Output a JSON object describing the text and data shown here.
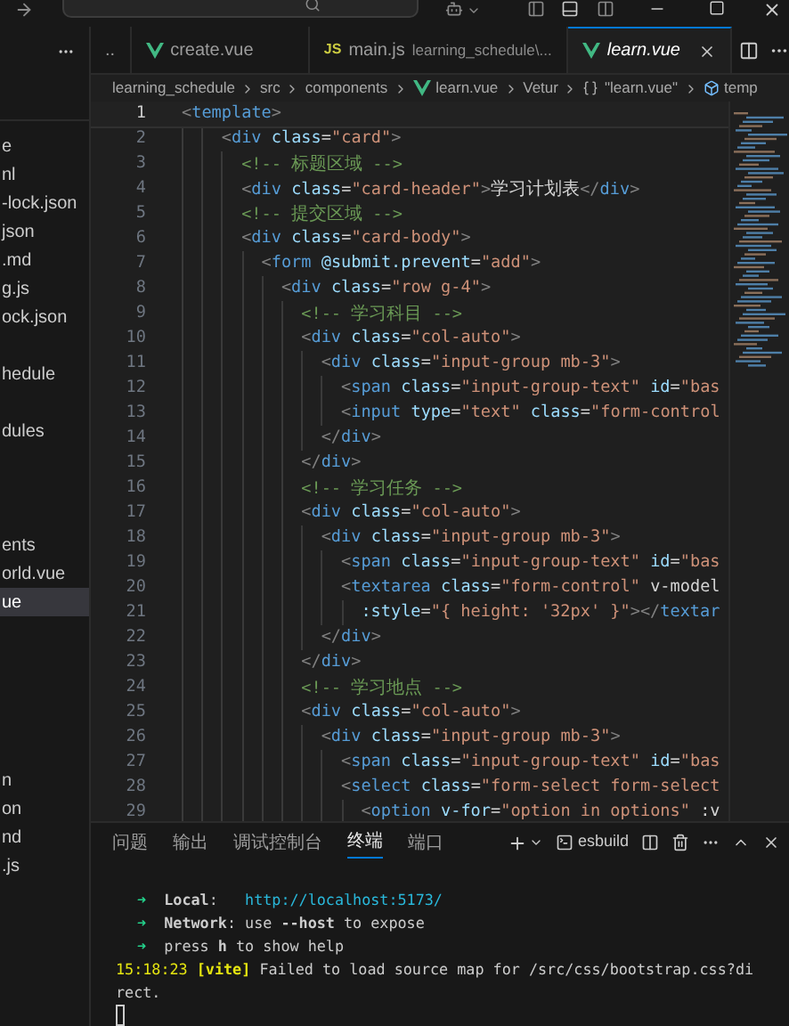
{
  "editor_tabs": [
    {
      "label": "..",
      "kind": "plain",
      "selected": false
    },
    {
      "label": "create.vue",
      "kind": "vue",
      "selected": false
    },
    {
      "label": "main.js",
      "kind": "js",
      "icon_text": "JS",
      "description": "learning_schedule\\...",
      "selected": false
    },
    {
      "label": "learn.vue",
      "kind": "vue",
      "selected": true
    }
  ],
  "breadcrumbs": [
    {
      "label": "learning_schedule",
      "kind": "plain"
    },
    {
      "label": "src",
      "kind": "plain"
    },
    {
      "label": "components",
      "kind": "plain"
    },
    {
      "label": "learn.vue",
      "kind": "vue"
    },
    {
      "label": "Vetur",
      "kind": "plain"
    },
    {
      "label": "\"learn.vue\"",
      "kind": "braces"
    },
    {
      "label": "temp",
      "kind": "cube"
    }
  ],
  "explorer": {
    "groups": [
      [
        {
          "label": "e",
          "selected": false
        },
        {
          "label": "nl",
          "selected": false
        },
        {
          "label": "-lock.json",
          "selected": false
        },
        {
          "label": "json",
          "selected": false
        },
        {
          "label": ".md",
          "selected": false
        },
        {
          "label": "g.js",
          "selected": false
        },
        {
          "label": "ock.json",
          "selected": false
        }
      ],
      [
        {
          "label": "hedule",
          "selected": false
        }
      ],
      [
        {
          "label": "dules",
          "selected": false
        }
      ],
      [
        {
          "label": "ents",
          "selected": false
        },
        {
          "label": "orld.vue",
          "selected": false
        },
        {
          "label": "ue",
          "selected": true
        }
      ],
      [
        {
          "label": "n",
          "selected": false
        },
        {
          "label": "on",
          "selected": false
        },
        {
          "label": "nd",
          "selected": false
        },
        {
          "label": ".js",
          "selected": false
        }
      ]
    ]
  },
  "editor": {
    "lines": [
      {
        "number": "1",
        "code": "<template>",
        "current": true
      },
      {
        "number": "2",
        "code": "    <div class=\"card\">",
        "current": false
      },
      {
        "number": "3",
        "code": "      <!-- 标题区域 -->",
        "current": false
      },
      {
        "number": "4",
        "code": "      <div class=\"card-header\">学习计划表</div>",
        "current": false
      },
      {
        "number": "5",
        "code": "      <!-- 提交区域 -->",
        "current": false
      },
      {
        "number": "6",
        "code": "      <div class=\"card-body\">",
        "current": false
      },
      {
        "number": "7",
        "code": "        <form @submit.prevent=\"add\">",
        "current": false
      },
      {
        "number": "8",
        "code": "          <div class=\"row g-4\">",
        "current": false
      },
      {
        "number": "9",
        "code": "            <!-- 学习科目 -->",
        "current": false
      },
      {
        "number": "10",
        "code": "            <div class=\"col-auto\">",
        "current": false
      },
      {
        "number": "11",
        "code": "              <div class=\"input-group mb-3\">",
        "current": false
      },
      {
        "number": "12",
        "code": "                <span class=\"input-group-text\" id=\"bas",
        "current": false
      },
      {
        "number": "13",
        "code": "                <input type=\"text\" class=\"form-control",
        "current": false
      },
      {
        "number": "14",
        "code": "              </div>",
        "current": false
      },
      {
        "number": "15",
        "code": "            </div>",
        "current": false
      },
      {
        "number": "16",
        "code": "            <!-- 学习任务 -->",
        "current": false
      },
      {
        "number": "17",
        "code": "            <div class=\"col-auto\">",
        "current": false
      },
      {
        "number": "18",
        "code": "              <div class=\"input-group mb-3\">",
        "current": false
      },
      {
        "number": "19",
        "code": "                <span class=\"input-group-text\" id=\"bas",
        "current": false
      },
      {
        "number": "20",
        "code": "                <textarea class=\"form-control\" v-model",
        "current": false
      },
      {
        "number": "21",
        "code": "                  :style=\"{ height: '32px' }\"></textar",
        "current": false
      },
      {
        "number": "22",
        "code": "              </div>",
        "current": false
      },
      {
        "number": "23",
        "code": "            </div>",
        "current": false
      },
      {
        "number": "24",
        "code": "            <!-- 学习地点 -->",
        "current": false
      },
      {
        "number": "25",
        "code": "            <div class=\"col-auto\">",
        "current": false
      },
      {
        "number": "26",
        "code": "              <div class=\"input-group mb-3\">",
        "current": false
      },
      {
        "number": "27",
        "code": "                <span class=\"input-group-text\" id=\"bas",
        "current": false
      },
      {
        "number": "28",
        "code": "                <select class=\"form-select form-select",
        "current": false
      },
      {
        "number": "29",
        "code": "                  <option v-for=\"option in options\" :v",
        "current": false
      }
    ]
  },
  "panel": {
    "tabs": [
      {
        "label": "问题",
        "selected": false
      },
      {
        "label": "输出",
        "selected": false
      },
      {
        "label": "调试控制台",
        "selected": false
      },
      {
        "label": "终端",
        "selected": true
      },
      {
        "label": "端口",
        "selected": false
      }
    ],
    "terminal_name": "esbuild",
    "terminal": [
      {
        "kind": "arrow",
        "marker": "➜",
        "text": "**Local**:   ",
        "link": "http://localhost:5173/"
      },
      {
        "kind": "arrow",
        "marker": "➜",
        "text": "**Network**: use **--host** to expose"
      },
      {
        "kind": "arrow",
        "marker": "➜",
        "text": "press **h** to show help"
      },
      {
        "kind": "log",
        "time": "15:18:23",
        "tag": "[vite]",
        "text": "Failed to load source map for /src/css/bootstrap.css?direct."
      }
    ]
  }
}
